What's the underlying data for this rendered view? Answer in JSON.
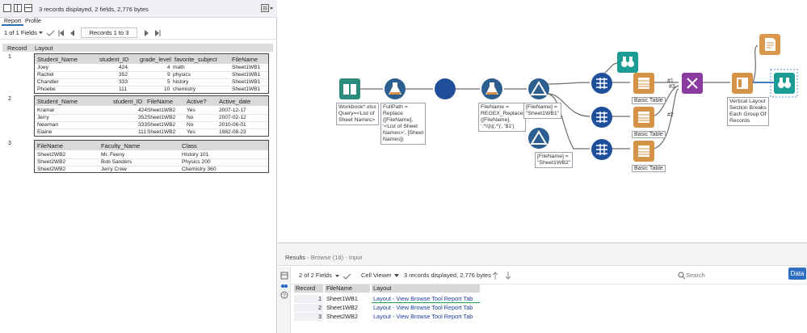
{
  "report": {
    "status": "3 records displayed, 2 fields, 2,776 bytes",
    "tabs": [
      "Report",
      "Profile"
    ],
    "fields_select": "1 of 1 Fields",
    "records_box": "Records 1 to 3",
    "columns": [
      "Record",
      "Layout"
    ],
    "records": [
      {
        "num": "1",
        "headers": [
          "Student_Name",
          "student_ID",
          "grade_level",
          "favorite_subject",
          "FileName"
        ],
        "rows": [
          [
            "Joey",
            "424",
            "4",
            "math",
            "Sheet1WB1"
          ],
          [
            "Rachel",
            "352",
            "9",
            "physics",
            "Sheet1WB1"
          ],
          [
            "Chandler",
            "333",
            "5",
            "history",
            "Sheet1WB1"
          ],
          [
            "Phoebe",
            "111",
            "10",
            "chemistry",
            "Sheet1WB1"
          ]
        ]
      },
      {
        "num": "2",
        "headers": [
          "Student_Name",
          "student_ID",
          "FileName",
          "Active?",
          "Active_date"
        ],
        "rows": [
          [
            "Kramar",
            "424",
            "Sheet1WB2",
            "Yes",
            "2007-12-17"
          ],
          [
            "Jerry",
            "352",
            "Sheet1WB2",
            "No",
            "2007-02-12"
          ],
          [
            "Newman",
            "333",
            "Sheet1WB2",
            "No",
            "2010-06-01"
          ],
          [
            "Elaine",
            "111",
            "Sheet1WB2",
            "Yes",
            "1982-08-23"
          ]
        ]
      },
      {
        "num": "3",
        "headers": [
          "FileName",
          "Faculty_Name",
          "Class"
        ],
        "rows": [
          [
            "Sheet2WB2",
            "Mr. Feeny",
            "History 101"
          ],
          [
            "Sheet2WB2",
            "Bob Sanders",
            "Physics 200"
          ],
          [
            "Sheet2WB2",
            "Jerry Crew",
            "Chemistry 360"
          ]
        ]
      }
    ]
  },
  "canvas": {
    "annotations": {
      "input": "Workbook*.xlsx\nQuery=<List of\nSheet Names>",
      "formula1": "FullPath =\nReplace\n([FileName],\n'<List of Sheet\nNames>', [Sheet\nNames])",
      "formula2": "FileName =\nREGEX_Replace\n([FileName],\n'.*\\\\|\\|(.*)', '$1')",
      "filter1": "[FileName] =\n\"Sheet1WB1\"",
      "filter2": "[FileName] =\n\"Sheet1WB2\"",
      "layout": "Vertical Layout\nSection Breaks\nEach Group Of\nRecords"
    },
    "basic_table_label": "Basic Table",
    "conn_labels": [
      "#1",
      "#3",
      "#2"
    ],
    "colors": {
      "input": "#2a8c7c",
      "formula": "#2c5f8f",
      "dynamic": "#1f4f9a",
      "table": "#d59347",
      "browse": "#1b9c94",
      "layout": "#8b3a9f",
      "render": "#d9984c"
    }
  },
  "results": {
    "title": "Results",
    "subtitle": "- Browse (18) - Input",
    "fields_select": "2 of 2 Fields",
    "cell_viewer": "Cell Viewer",
    "status": "3 records displayed, 2,776 bytes",
    "search_placeholder": "Search",
    "data_button": "Data",
    "columns": [
      "Record",
      "FileName",
      "Layout"
    ],
    "rows": [
      [
        "1",
        "Sheet1WB1",
        "Layout - View Browse Tool Report Tab"
      ],
      [
        "2",
        "Sheet1WB2",
        "Layout - View Browse Tool Report Tab"
      ],
      [
        "3",
        "Sheet2WB2",
        "Layout - View Browse Tool Report Tab"
      ]
    ]
  }
}
